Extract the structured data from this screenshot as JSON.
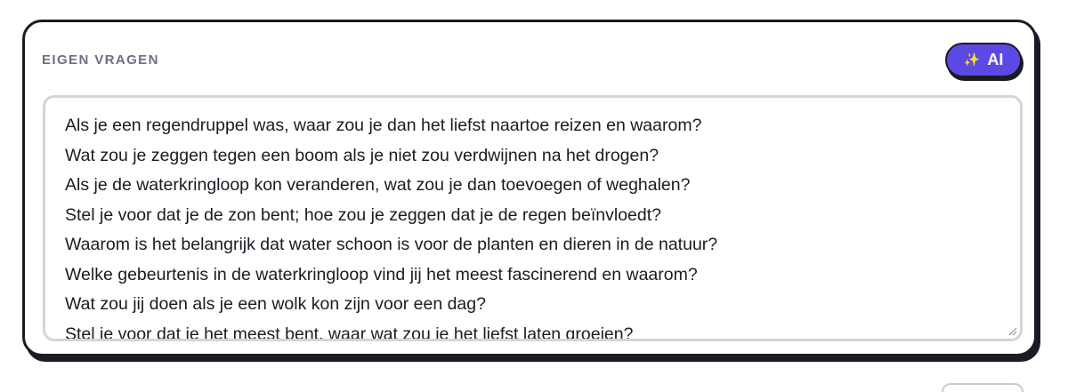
{
  "section": {
    "title": "EIGEN VRAGEN"
  },
  "ai_button": {
    "icon": "sparkle-icon",
    "icon_glyph": "✨",
    "label": "AI"
  },
  "questions": [
    "Als je een regendruppel was, waar zou je dan het liefst naartoe reizen en waarom?",
    "Wat zou je zeggen tegen een boom als je niet zou verdwijnen na het drogen?",
    "Als je de waterkringloop kon veranderen, wat zou je dan toevoegen of weghalen?",
    "Stel je voor dat je de zon bent; hoe zou je zeggen dat je de regen beïnvloedt?",
    "Waarom is het belangrijk dat water schoon is voor de planten en dieren in de natuur?",
    "Welke gebeurtenis in de waterkringloop vind jij het meest fascinerend en waarom?",
    "Wat zou jij doen als je een wolk kon zijn voor een dag?",
    "Stel je voor dat je het meest bent, waar wat zou je het liefst laten groeien?"
  ],
  "colors": {
    "accent": "#5a4ae3",
    "border": "#1b1b23",
    "title": "#6b7080",
    "field_border": "#d3d5d9"
  }
}
